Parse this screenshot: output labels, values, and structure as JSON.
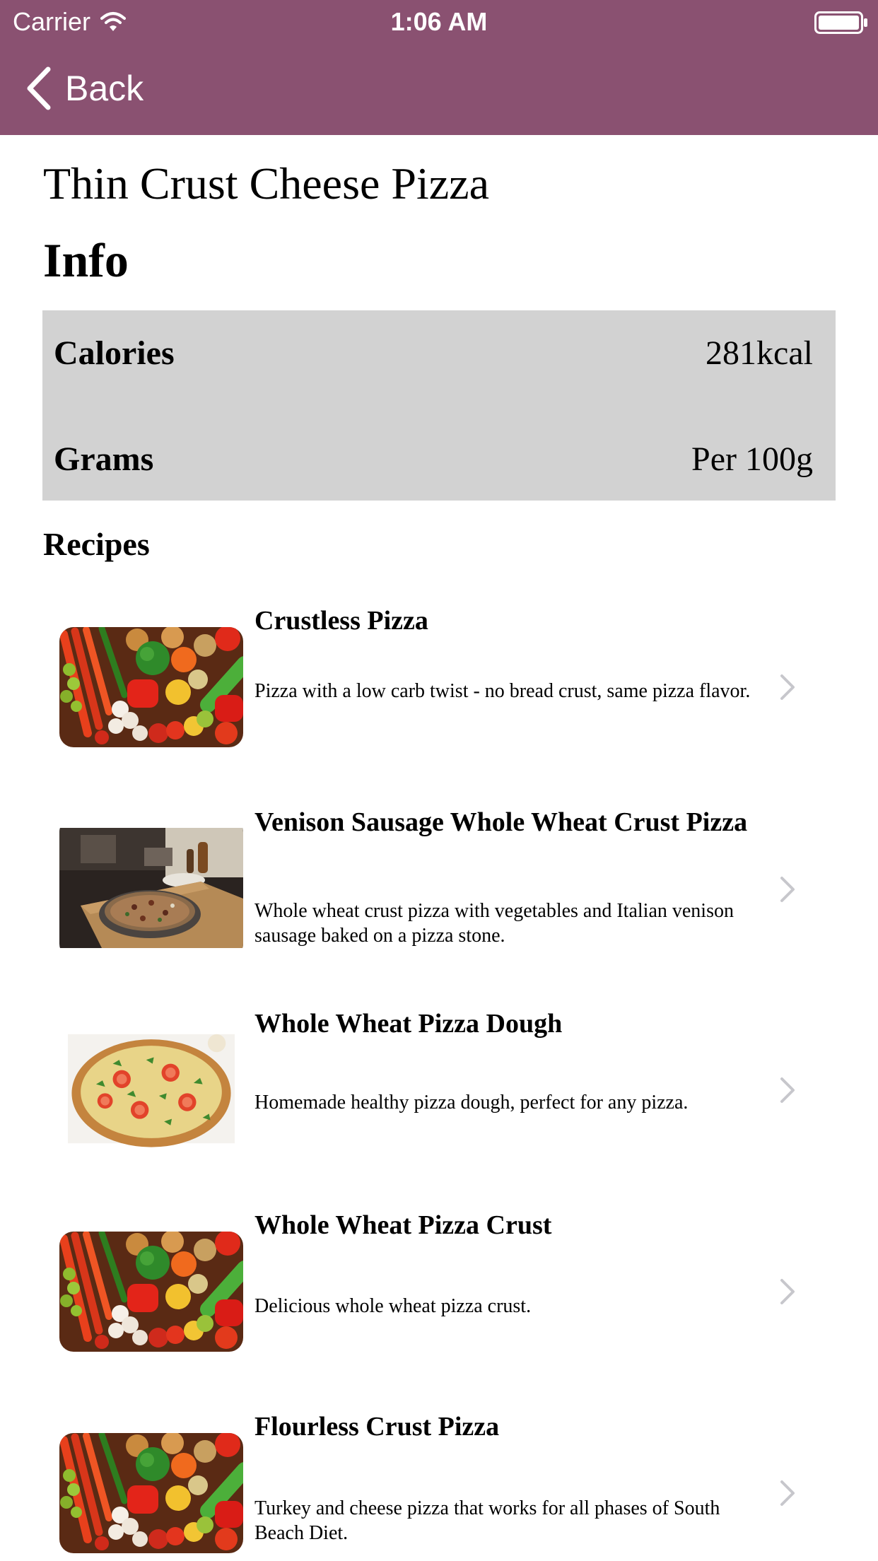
{
  "status_bar": {
    "carrier": "Carrier",
    "time": "1:06 AM"
  },
  "nav": {
    "back_label": "Back",
    "bar_color": "#8a5171"
  },
  "food": {
    "name": "Thin Crust Cheese Pizza"
  },
  "info": {
    "heading": "Info",
    "rows": [
      {
        "label": "Calories",
        "value": "281kcal"
      },
      {
        "label": "Grams",
        "value": "Per 100g"
      }
    ]
  },
  "recipes": {
    "heading": "Recipes",
    "items": [
      {
        "title": "Crustless Pizza",
        "description": "Pizza with a low carb twist - no bread crust, same pizza flavor.",
        "image": "vegetables-photo"
      },
      {
        "title": "Venison Sausage Whole Wheat Crust Pizza",
        "description": "Whole wheat crust pizza with vegetables and Italian venison sausage baked on a pizza stone.",
        "image": "pizza-on-board-photo"
      },
      {
        "title": "Whole Wheat Pizza Dough",
        "description": "Homemade healthy pizza dough, perfect for any pizza.",
        "image": "pizza-photo"
      },
      {
        "title": "Whole Wheat Pizza Crust",
        "description": "Delicious whole wheat pizza crust.",
        "image": "vegetables-photo"
      },
      {
        "title": "Flourless Crust Pizza",
        "description": "Turkey and cheese pizza that works for all phases of South Beach Diet.",
        "image": "vegetables-photo"
      }
    ]
  },
  "icons": {
    "back": "chevron-left-icon",
    "row_disclosure": "chevron-right-icon",
    "wifi": "wifi-icon",
    "battery": "battery-icon"
  }
}
